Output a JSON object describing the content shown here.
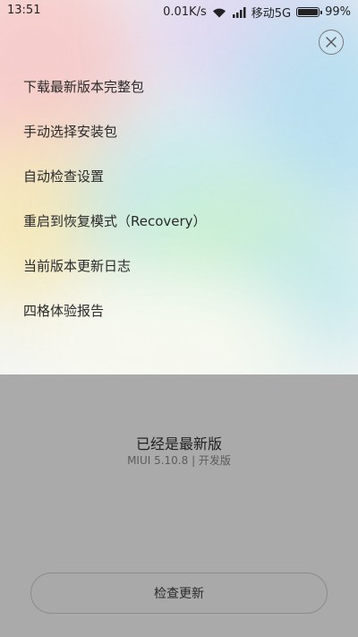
{
  "status_bar": {
    "time": "13:51",
    "speed": "0.01K/s",
    "carrier": "移动5G",
    "battery": "99%",
    "battery_level": 0.99
  },
  "menu": {
    "items": [
      {
        "label": "下载最新版本完整包"
      },
      {
        "label": "手动选择安装包"
      },
      {
        "label": "自动检查设置"
      },
      {
        "label": "重启到恢复模式（Recovery）"
      },
      {
        "label": "当前版本更新日志"
      },
      {
        "label": "四格体验报告"
      }
    ]
  },
  "update_status": {
    "title": "已经是最新版",
    "version": "MIUI 5.10.8 | 开发版"
  },
  "check_button": {
    "label": "检查更新"
  },
  "icons": {
    "close": "close-icon",
    "wifi": "wifi-icon",
    "signal": "signal-icon",
    "battery": "battery-icon"
  }
}
